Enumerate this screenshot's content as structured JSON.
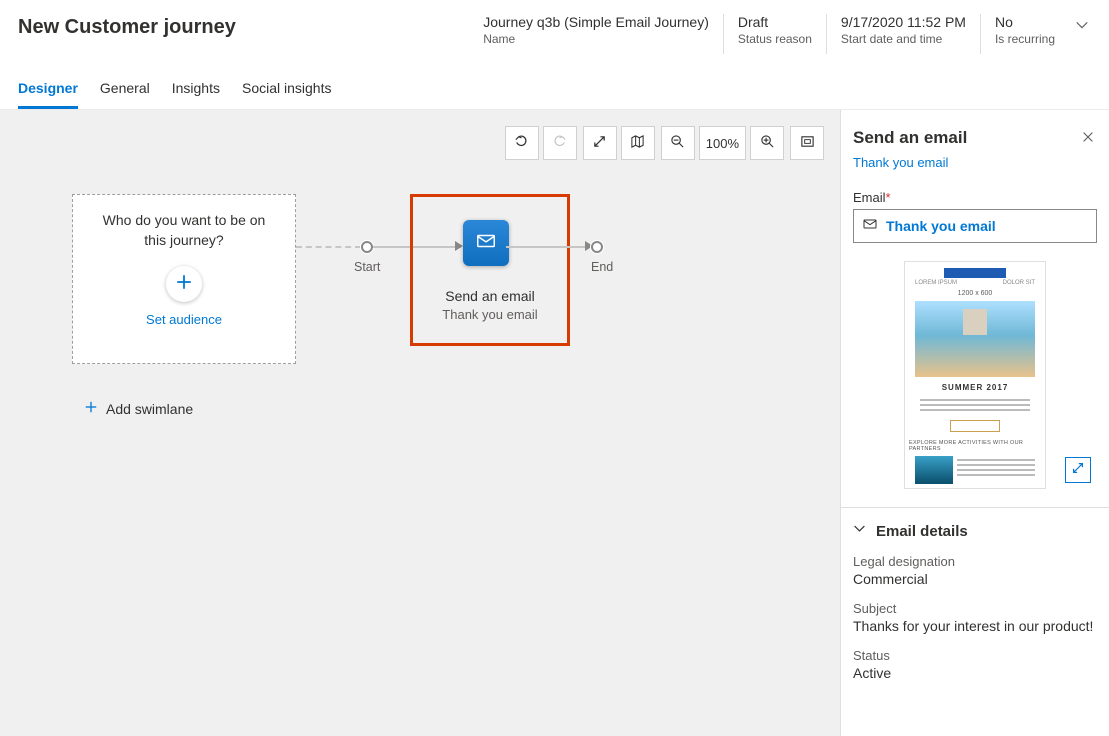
{
  "header": {
    "title": "New Customer journey",
    "meta": [
      {
        "value": "Journey q3b (Simple Email Journey)",
        "label": "Name"
      },
      {
        "value": "Draft",
        "label": "Status reason"
      },
      {
        "value": "9/17/2020 11:52 PM",
        "label": "Start date and time"
      },
      {
        "value": "No",
        "label": "Is recurring"
      }
    ]
  },
  "tabs": [
    "Designer",
    "General",
    "Insights",
    "Social insights"
  ],
  "activeTab": 0,
  "toolbar": {
    "zoom_label": "100%"
  },
  "canvas": {
    "audience_question": "Who do you want to be on this journey?",
    "set_audience": "Set audience",
    "start_label": "Start",
    "end_label": "End",
    "tile_title": "Send an email",
    "tile_subtitle": "Thank you email",
    "add_swimlane": "Add swimlane"
  },
  "side": {
    "title": "Send an email",
    "link": "Thank you email",
    "email_label": "Email",
    "email_value": "Thank you email",
    "preview_caption": "SUMMER 2017",
    "preview_sub": "EXPLORE MORE ACTIVITIES WITH OUR PARTNERS",
    "section_title": "Email details",
    "details": {
      "legal_label": "Legal designation",
      "legal_value": "Commercial",
      "subject_label": "Subject",
      "subject_value": "Thanks for your interest in our product!",
      "status_label": "Status",
      "status_value": "Active"
    }
  }
}
